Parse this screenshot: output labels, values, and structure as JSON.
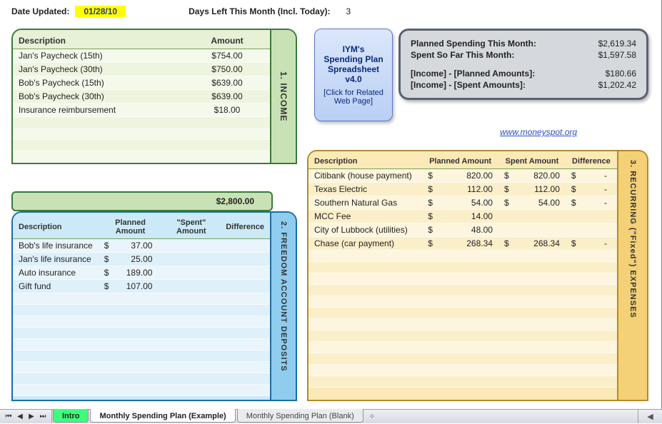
{
  "top": {
    "date_updated_label": "Date Updated:",
    "date_updated_value": "01/28/10",
    "days_left_label": "Days Left This Month (Incl. Today):",
    "days_left_value": "3"
  },
  "badge": {
    "line1": "IYM's",
    "line2": "Spending Plan",
    "line3": "Spreadsheet",
    "line4": "v4.0",
    "link_text": "[Click for Related Web Page]"
  },
  "summary": {
    "rows": [
      {
        "label": "Planned Spending This Month:",
        "value": "$2,619.34"
      },
      {
        "label": "Spent So Far This Month:",
        "value": "$1,597.58"
      }
    ],
    "rows2": [
      {
        "label": "[Income] - [Planned Amounts]:",
        "value": "$180.66"
      },
      {
        "label": "[Income] - [Spent Amounts]:",
        "value": "$1,202.42"
      }
    ]
  },
  "link": "www.moneyspot.org",
  "income": {
    "tab": "1.  INCOME",
    "headers": {
      "desc": "Description",
      "amount": "Amount"
    },
    "rows": [
      {
        "desc": "Jan's Paycheck (15th)",
        "amount": "$754.00"
      },
      {
        "desc": "Jan's Paycheck (30th)",
        "amount": "$750.00"
      },
      {
        "desc": "Bob's Paycheck (15th)",
        "amount": "$639.00"
      },
      {
        "desc": "Bob's Paycheck (30th)",
        "amount": "$639.00"
      },
      {
        "desc": "Insurance reimbursement",
        "amount": "$18.00"
      }
    ],
    "total": "$2,800.00"
  },
  "freedom": {
    "tab": "2.  FREEDOM ACCOUNT DEPOSITS",
    "headers": {
      "desc": "Description",
      "planned": "Planned Amount",
      "spent": "\"Spent\" Amount",
      "diff": "Difference"
    },
    "rows": [
      {
        "desc": "Bob's life insurance",
        "planned": "37.00",
        "spent": "",
        "diff": ""
      },
      {
        "desc": "Jan's life insurance",
        "planned": "25.00",
        "spent": "",
        "diff": ""
      },
      {
        "desc": "Auto insurance",
        "planned": "189.00",
        "spent": "",
        "diff": ""
      },
      {
        "desc": "Gift fund",
        "planned": "107.00",
        "spent": "",
        "diff": ""
      }
    ]
  },
  "recurring": {
    "tab": "3.  RECURRING (\"Fixed\") EXPENSES",
    "headers": {
      "desc": "Description",
      "planned": "Planned Amount",
      "spent": "Spent Amount",
      "diff": "Difference"
    },
    "rows": [
      {
        "desc": "Citibank (house payment)",
        "planned": "820.00",
        "spent": "820.00",
        "diff": "-"
      },
      {
        "desc": "Texas Electric",
        "planned": "112.00",
        "spent": "112.00",
        "diff": "-"
      },
      {
        "desc": "Southern Natural Gas",
        "planned": "54.00",
        "spent": "54.00",
        "diff": "-"
      },
      {
        "desc": "MCC Fee",
        "planned": "14.00",
        "spent": "",
        "diff": ""
      },
      {
        "desc": "City of Lubbock (utilities)",
        "planned": "48.00",
        "spent": "",
        "diff": ""
      },
      {
        "desc": "Chase (car payment)",
        "planned": "268.34",
        "spent": "268.34",
        "diff": "-"
      }
    ]
  },
  "tabs": {
    "intro": "Intro",
    "example": "Monthly Spending Plan (Example)",
    "blank": "Monthly Spending Plan (Blank)"
  }
}
